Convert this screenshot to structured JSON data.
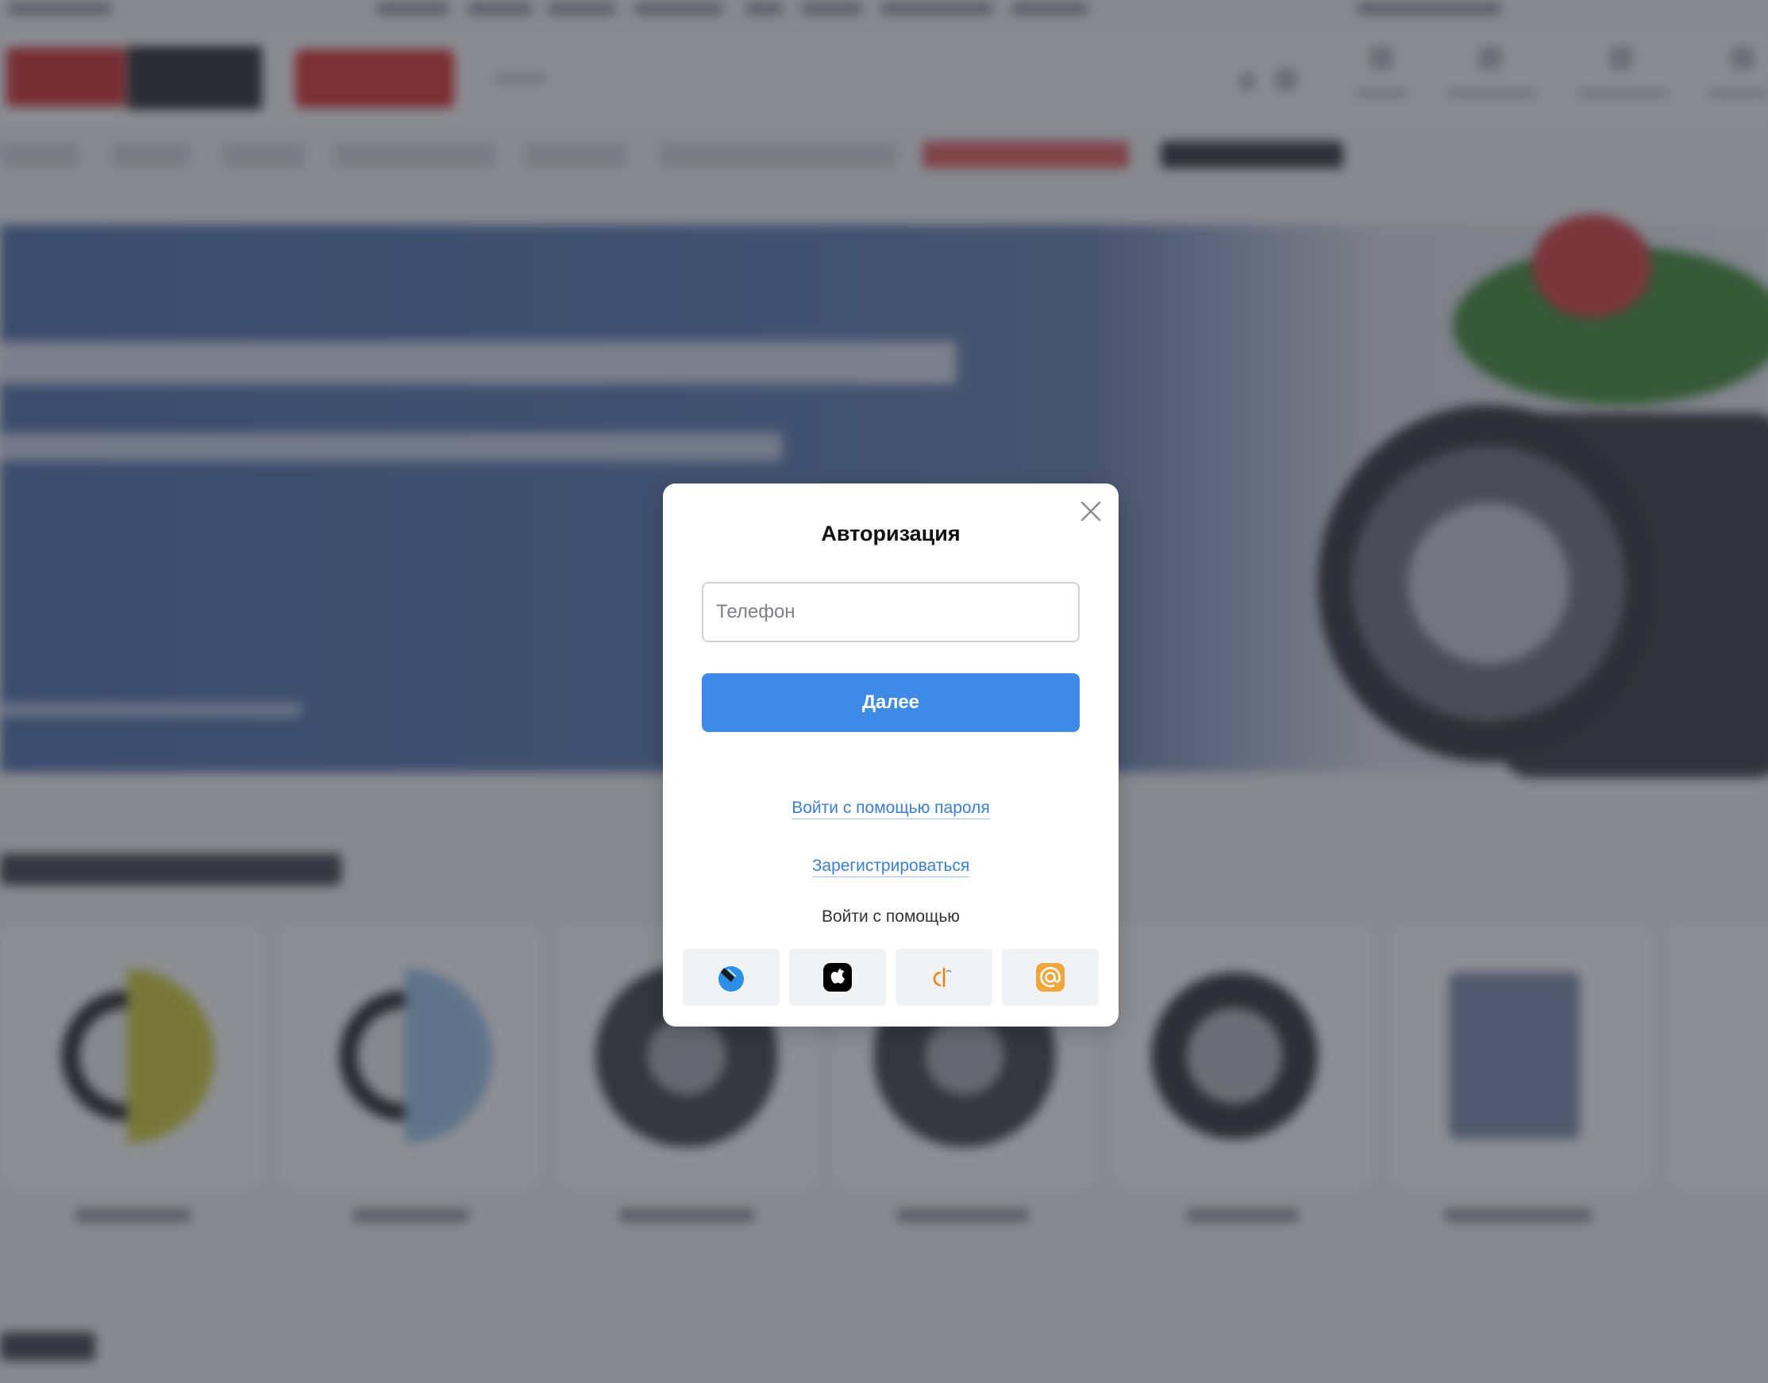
{
  "modal": {
    "title": "Авторизация",
    "phone_placeholder": "Телефон",
    "phone_value": "",
    "next_button_label": "Далее",
    "password_login_link": "Войти с помощью пароля",
    "register_link": "Зарегистрироваться",
    "social_login_label": "Войти с помощью",
    "social_providers": [
      {
        "icon": "vk-id-icon",
        "color": "#2d8fe6"
      },
      {
        "icon": "apple-icon",
        "color": "#000000"
      },
      {
        "icon": "odnoklassniki-icon",
        "color": "#ee8208"
      },
      {
        "icon": "mail-ru-icon",
        "color": "#f0a63b"
      }
    ]
  },
  "colors": {
    "primary_button": "#3f8ae6",
    "link": "#3a7ed8",
    "overlay": "rgba(45,50,60,0.55)",
    "input_border": "#cfd2d8"
  }
}
